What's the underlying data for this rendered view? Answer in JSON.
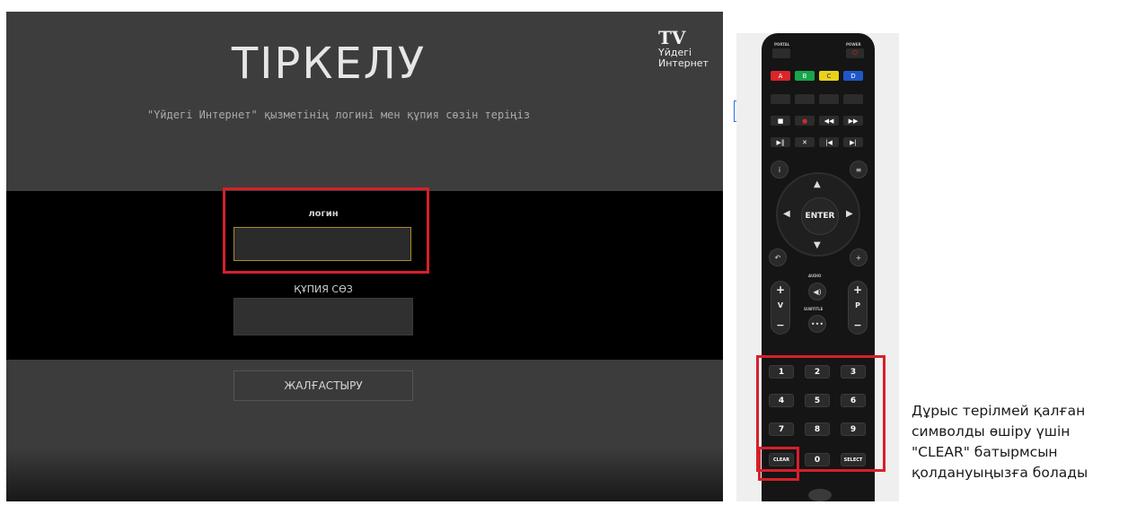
{
  "tv_screen": {
    "title": "ТІРКЕЛУ",
    "subtitle": "\"Үйдегі Интернет\" қызметінің логині мен құпия сөзін теріңіз",
    "brand": {
      "mark": "TV",
      "line1": "Үйдегі",
      "line2": "Интернет"
    },
    "login_label": "логин",
    "login_value": "",
    "password_label": "ҚҰПИЯ СӨЗ",
    "password_value": "",
    "continue_label": "ЖАЛҒАСТЫРУ"
  },
  "remote": {
    "top_labels": {
      "portal": "PORTAL",
      "power": "POWER"
    },
    "color_buttons": [
      {
        "label": "A",
        "color": "#d8262a"
      },
      {
        "label": "B",
        "color": "#17a64a"
      },
      {
        "label": "C",
        "color": "#e8d21c"
      },
      {
        "label": "D",
        "color": "#1f57c8"
      }
    ],
    "enter_label": "ENTER",
    "volume": {
      "plus": "+",
      "letter": "V",
      "minus": "−"
    },
    "program": {
      "plus": "+",
      "letter": "P",
      "minus": "−"
    },
    "audio_label": "AUDIO",
    "subtitle_label": "SUBTITLE",
    "keypad": [
      [
        "1",
        "2",
        "3"
      ],
      [
        "4",
        "5",
        "6"
      ],
      [
        "7",
        "8",
        "9"
      ],
      [
        "CLEAR",
        "0",
        "SELECT"
      ]
    ]
  },
  "note": {
    "line1": "Дұрыс терілмей қалған",
    "line2": "символды өшіру үшін",
    "line3": "\"CLEAR\" батырмсын",
    "line4": "қолдануыңызға болады"
  },
  "colors": {
    "highlight": "#d6202a",
    "focus_border": "#b08a2a",
    "tv_bg": "#3c3c3c"
  }
}
